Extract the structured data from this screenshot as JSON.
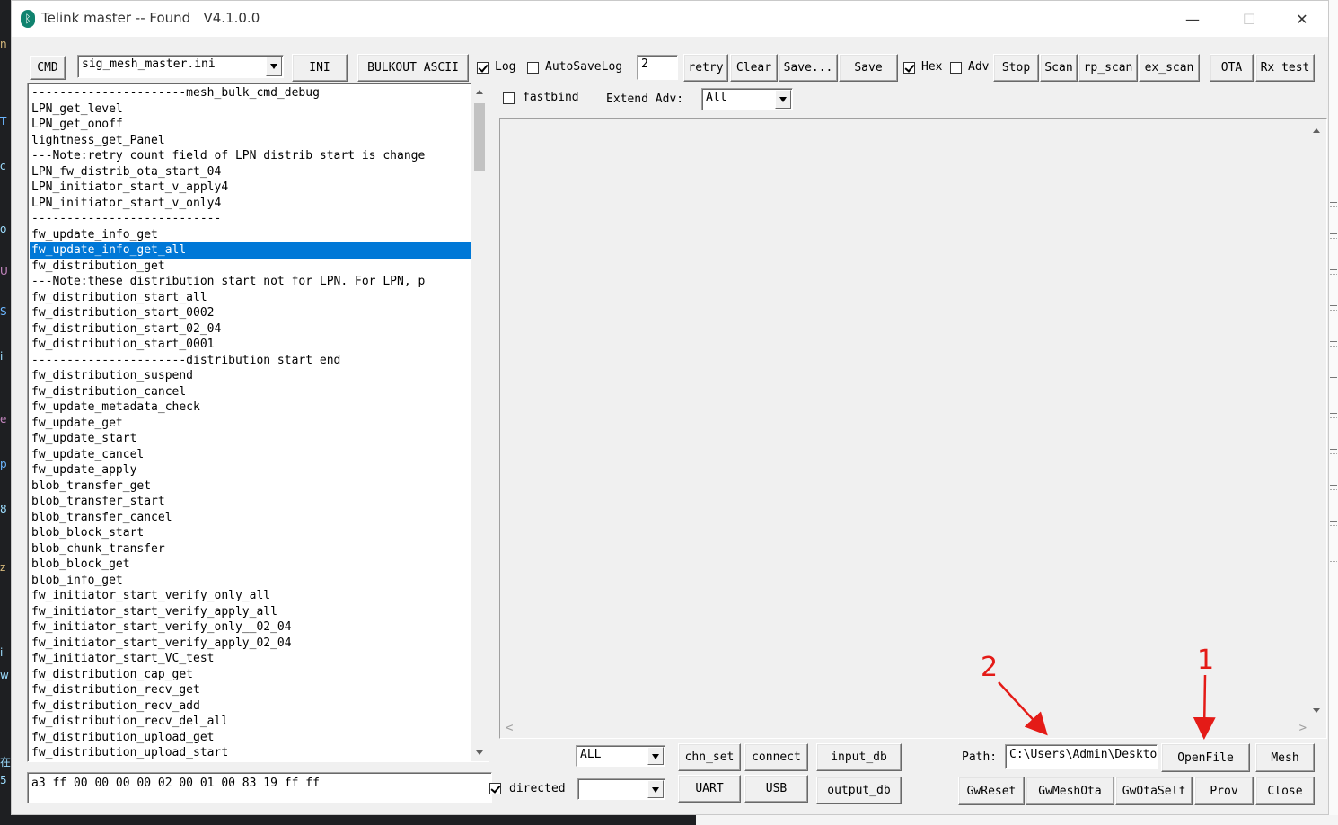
{
  "window": {
    "title": "Telink master -- Found   V4.1.0.0",
    "icon": "bluetooth-icon",
    "controls": {
      "minimize": "—",
      "maximize": "☐",
      "close": "✕"
    }
  },
  "toolbar": {
    "cmd": "CMD",
    "ini_file": "sig_mesh_master.ini",
    "ini": "INI",
    "bulkout_ascii": "BULKOUT ASCII",
    "log_label": "Log",
    "log_checked": true,
    "autosave_label": "AutoSaveLog",
    "autosave_checked": false,
    "retry_value": "2",
    "retry": "retry",
    "clear": "Clear",
    "save_as": "Save...",
    "save": "Save",
    "hex_label": "Hex",
    "hex_checked": true,
    "adv_label": "Adv",
    "adv_checked": false,
    "stop": "Stop",
    "scan": "Scan",
    "rp_scan": "rp_scan",
    "ex_scan": "ex_scan",
    "ota": "OTA",
    "rx_test": "Rx test"
  },
  "options": {
    "fastbind_label": "fastbind",
    "fastbind_checked": false,
    "extend_adv_label": "Extend Adv:",
    "extend_adv_value": "All"
  },
  "command_list": {
    "selected_index": 10,
    "items": [
      "----------------------mesh_bulk_cmd_debug",
      "LPN_get_level",
      "LPN_get_onoff",
      "lightness_get_Panel",
      "---Note:retry count field of LPN distrib start is change",
      "LPN_fw_distrib_ota_start_04",
      "LPN_initiator_start_v_apply4",
      "LPN_initiator_start_v_only4",
      "---------------------------",
      "fw_update_info_get",
      "fw_update_info_get_all",
      "fw_distribution_get",
      "---Note:these distribution start not for LPN. For LPN, p",
      "fw_distribution_start_all",
      "fw_distribution_start_0002",
      "fw_distribution_start_02_04",
      "fw_distribution_start_0001",
      "----------------------distribution start end",
      "fw_distribution_suspend",
      "fw_distribution_cancel",
      "fw_update_metadata_check",
      "fw_update_get",
      "fw_update_start",
      "fw_update_cancel",
      "fw_update_apply",
      "blob_transfer_get",
      "blob_transfer_start",
      "blob_transfer_cancel",
      "blob_block_start",
      "blob_chunk_transfer",
      "blob_block_get",
      "blob_info_get",
      "fw_initiator_start_verify_only_all",
      "fw_initiator_start_verify_apply_all",
      "fw_initiator_start_verify_only__02_04",
      "fw_initiator_start_verify_apply_02_04",
      "fw_initiator_start_VC_test",
      "fw_distribution_cap_get",
      "fw_distribution_recv_get",
      "fw_distribution_recv_add",
      "fw_distribution_recv_del_all",
      "fw_distribution_upload_get",
      "fw_distribution_upload_start"
    ]
  },
  "command_input": "a3 ff 00 00 00 00 02 00 01 00 83 19 ff ff",
  "directed": {
    "label": "directed",
    "checked": true,
    "value": ""
  },
  "bottom": {
    "all_value": "ALL",
    "chn_set": "chn_set",
    "connect": "connect",
    "input_db": "input_db",
    "uart": "UART",
    "usb": "USB",
    "output_db": "output_db",
    "path_label": "Path:",
    "path_value": "C:\\Users\\Admin\\Desktop",
    "openfile": "OpenFile",
    "mesh": "Mesh",
    "gw_reset": "GwReset",
    "gw_mesh_ota": "GwMeshOta",
    "gw_ota_self": "GwOtaSelf",
    "prov": "Prov",
    "close": "Close"
  },
  "annotations": {
    "one": "1",
    "two": "2",
    "color": "#e41b17"
  }
}
